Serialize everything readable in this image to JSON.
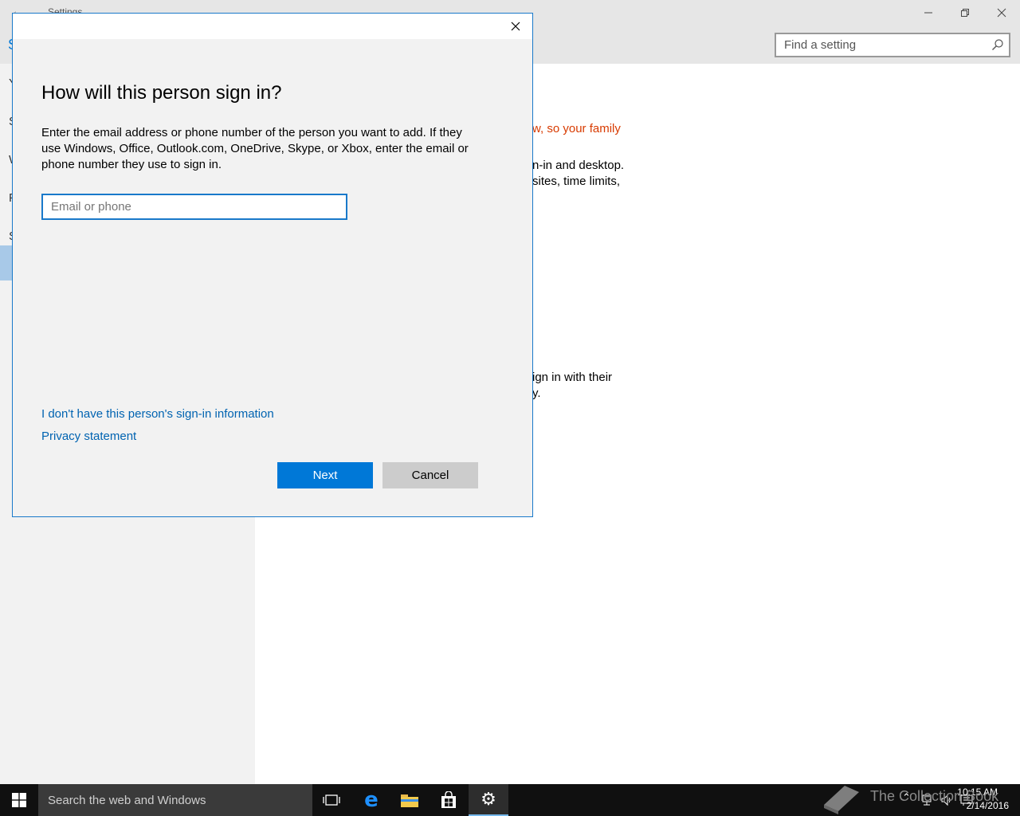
{
  "settings_window": {
    "title": "Settings",
    "search_placeholder": "Find a setting",
    "sidebar_letters": [
      "Y",
      "S",
      "W",
      "F",
      "S"
    ],
    "content_lines": [
      "w, so your family",
      "n-in and desktop.",
      "sites, time limits,",
      "ign in with their",
      "y."
    ]
  },
  "dialog": {
    "heading": "How will this person sign in?",
    "description": "Enter the email address or phone number of the person you want to add. If they use Windows, Office, Outlook.com, OneDrive, Skype, or Xbox, enter the email or phone number they use to sign in.",
    "input_placeholder": "Email or phone",
    "input_value": "",
    "link_no_info": "I don't have this person's sign-in information",
    "link_privacy": "Privacy statement",
    "next_label": "Next",
    "cancel_label": "Cancel"
  },
  "taskbar": {
    "search_placeholder": "Search the web and Windows",
    "time": "10:15 AM",
    "date": "2/14/2016",
    "watermark": "The Collection Book"
  },
  "colors": {
    "accent": "#0078d7",
    "link": "#0063b1",
    "warning_text": "#d83b01"
  },
  "icons": [
    "back-arrow-icon",
    "minimize-icon",
    "restore-icon",
    "close-icon",
    "search-icon",
    "windows-start-icon",
    "task-view-icon",
    "edge-icon",
    "file-explorer-icon",
    "store-icon",
    "settings-gear-icon",
    "chevron-up-icon",
    "network-icon",
    "volume-icon",
    "action-center-icon"
  ]
}
